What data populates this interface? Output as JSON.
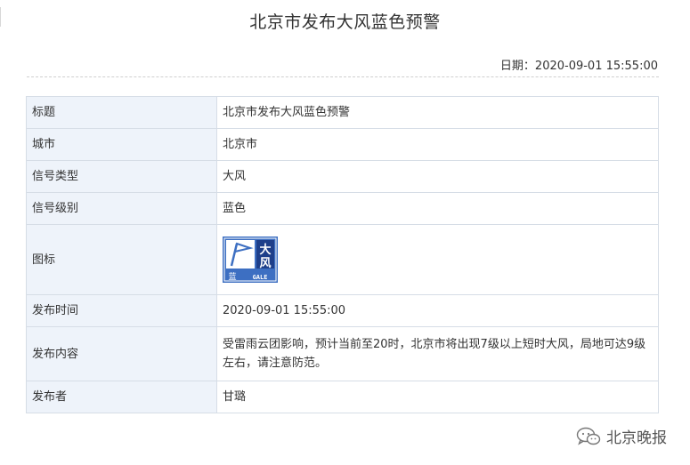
{
  "header": {
    "title": "北京市发布大风蓝色预警",
    "date_line": "日期：2020-09-01 15:55:00"
  },
  "table": {
    "rows": [
      {
        "key": "标题",
        "value": "北京市发布大风蓝色预警"
      },
      {
        "key": "城市",
        "value": "北京市"
      },
      {
        "key": "信号类型",
        "value": "大风"
      },
      {
        "key": "信号级别",
        "value": "蓝色"
      },
      {
        "key": "图标",
        "icon": "gale-blue-warning-icon"
      },
      {
        "key": "发布时间",
        "value": "2020-09-01 15:55:00"
      },
      {
        "key": "发布内容",
        "value": "受雷雨云团影响，预计当前至20时，北京市将出现7级以上短时大风，局地可达9级左右，请注意防范。"
      },
      {
        "key": "发布者",
        "value": "甘璐"
      }
    ]
  },
  "icon": {
    "big_char_1": "大",
    "big_char_2": "风",
    "level_char": "蓝",
    "english": "GALE",
    "colors": {
      "blue": "#3d6fc2",
      "dark_blue": "#1e3f8a",
      "white": "#ffffff"
    }
  },
  "watermark": {
    "text": "北京晚报",
    "icon": "wechat-icon"
  }
}
